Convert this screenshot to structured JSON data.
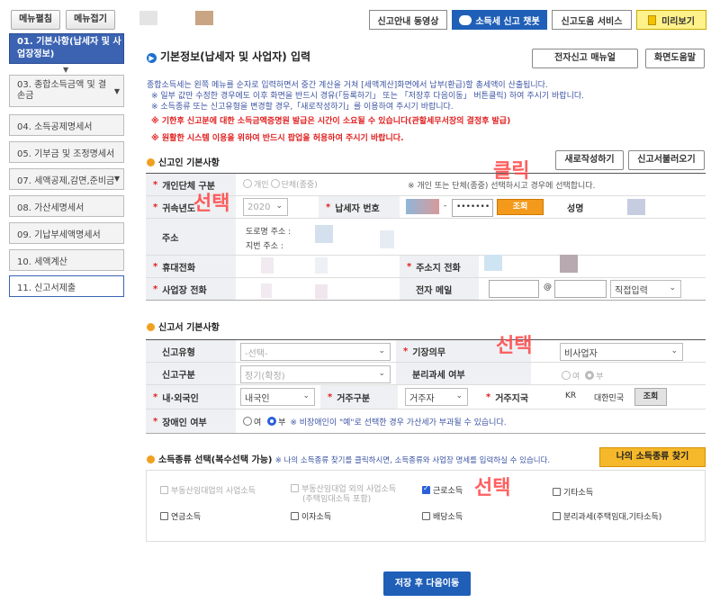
{
  "topbar": {
    "expand_label": "메뉴펼침",
    "collapse_label": "메뉴접기",
    "video_label": "신고안내 동영상",
    "chatbot_label": "소득세 신고 챗봇",
    "help_service_label": "신고도움 서비스",
    "preview_label": "미리보기"
  },
  "sidebar": {
    "items": [
      {
        "label": "01. 기본사항(납세자 및 사업장정보)"
      },
      {
        "label": "03. 종합소득금액 및 결손금"
      },
      {
        "label": "04. 소득공제명세서"
      },
      {
        "label": "05. 기부금 및 조정명세서"
      },
      {
        "label": "07. 세액공제,감면,준비금"
      },
      {
        "label": "08. 가산세명세서"
      },
      {
        "label": "09. 기납부세액명세서"
      },
      {
        "label": "10. 세액계산"
      },
      {
        "label": "11. 신고서제출"
      }
    ]
  },
  "page": {
    "title": "기본정보(납세자 및 사업자) 입력",
    "manual_button": "전자신고 매뉴얼",
    "screen_help_button": "화면도움말",
    "intro": "종합소득세는 왼쪽 메뉴를 순자로 입력하면서 중간 계산을 거쳐 [세액계산]화면에서 납부(환급)할 총세액이 산출됩니다.",
    "notes": [
      "※ 일부 값만 수정한 경우에도 이후 화면을 반드시 경유(「등록하기」 또는 「저장후 다음이동」 버튼클릭) 하여 주시기 바랍니다.",
      "※ 소득종류 또는 신고유형을 변경할 경우,「새로작성하기」를 이용하여 주시기 바랍니다.",
      "※ 기한후 신고분에 대한 소득금액증명원 발급은 시간이 소요될 수 있습니다(관할세무서장의 결정후 발급)",
      "※ 원활한 시스템 이용을 위하여 반드시 팝업을 허용하여 주시기 바랍니다."
    ]
  },
  "basic": {
    "section_title": "신고인 기본사항",
    "new_button": "새로작성하기",
    "load_button": "신고서불러오기",
    "type_label": "개인단체 구분",
    "type_personal": "개인",
    "type_group": "단체(종중)",
    "type_note": "※ 개인 또는 단체(종중) 선택하시고 경우에 선택합니다.",
    "year_label": "귀속년도",
    "year_value": "2020",
    "taxpayer_no_label": "납세자 번호",
    "taxpayer_no_mask": "•••••••",
    "lookup_button": "조회",
    "name_label": "성명",
    "address_label": "주소",
    "road_address": "도로명 주소 :",
    "lot_address": "지번 주소 :",
    "mobile_label": "휴대전화",
    "home_phone_label": "주소지 전화",
    "biz_phone_label": "사업장 전화",
    "email_label": "전자 메일",
    "email_at": "@",
    "email_domain": "직접입력"
  },
  "report": {
    "section_title": "신고서 기본사항",
    "type_label": "신고유형",
    "type_value": "-선택-",
    "bookkeeping_label": "기장의무",
    "bookkeeping_value": "비사업자",
    "category_label": "신고구분",
    "category_value": "정기(확정)",
    "separate_label": "분리과세 여부",
    "separate_yes": "여",
    "separate_no": "부",
    "nationality_label": "내·외국인",
    "nationality_value": "내국인",
    "residence_label": "거주구분",
    "residence_value": "거주자",
    "region_label": "거주지국",
    "region_code": "KR",
    "region_name": "대한민국",
    "region_lookup": "조회",
    "disabled_label": "장애인 여부",
    "disabled_yes": "여",
    "disabled_no": "부",
    "disabled_note": "※ 비장애인이 \"예\"로 선택한 경우 가산세가 부과될 수 있습니다."
  },
  "income": {
    "section_title": "소득종류 선택(복수선택 가능)",
    "section_note": "※ 나의 소득종류 찾기를 클릭하시면, 소득종류와 사업장 명세를 입력하실 수 있습니다.",
    "find_button": "나의 소득종류 찾기",
    "options": {
      "real_estate": "부동산임대업의 사업소득",
      "other_biz": "부동산임대업 외의 사업소득",
      "other_biz_sub": "(주택임대소득 포함)",
      "wage": "근로소득",
      "other": "기타소득",
      "pension": "연금소득",
      "interest": "이자소득",
      "dividend": "배당소득",
      "separate": "분리과세(주택임대,기타소득)"
    }
  },
  "footer": {
    "save_next": "저장 후 다음이동"
  },
  "annotations": {
    "select1": "선택",
    "click": "클릭",
    "select2": "선택",
    "select3": "선택"
  },
  "colors": {
    "accent": "#3b63b2",
    "orange": "#f0a020",
    "required": "#e02020",
    "label_bg": "#eef0f3"
  }
}
